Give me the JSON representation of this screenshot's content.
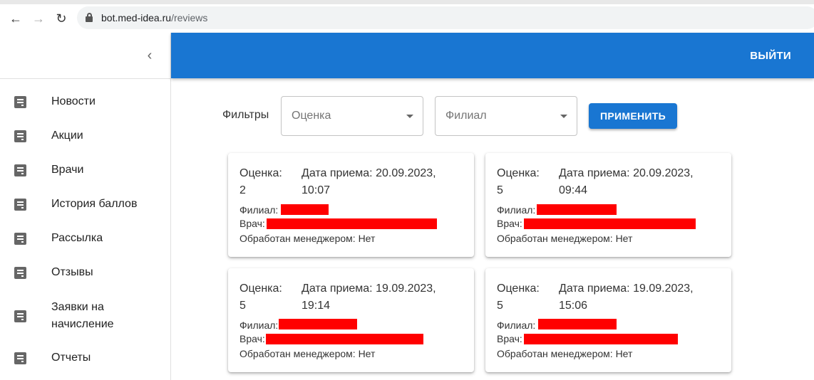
{
  "browser": {
    "url_host": "bot.med-idea.ru",
    "url_path": "/reviews"
  },
  "sidebar": {
    "items": [
      {
        "label": "Новости"
      },
      {
        "label": "Акции"
      },
      {
        "label": "Врачи"
      },
      {
        "label": "История баллов"
      },
      {
        "label": "Рассылка"
      },
      {
        "label": "Отзывы"
      },
      {
        "label": "Заявки на начисление"
      },
      {
        "label": "Отчеты"
      }
    ]
  },
  "header": {
    "logout_label": "ВЫЙТИ",
    "accent_color": "#1976d2"
  },
  "filters": {
    "label": "Фильтры",
    "rating_placeholder": "Оценка",
    "branch_placeholder": "Филиал",
    "apply_label": "ПРИМЕНИТЬ"
  },
  "reviews": [
    {
      "rating_label": "Оценка:",
      "rating": "2",
      "date_label": "Дата приема:",
      "date": "20.09.2023,",
      "time": "10:07",
      "branch_label": "Филиал:",
      "doctor_label": "Врач:",
      "processed_label": "Обработан менеджером:",
      "processed": "Нет"
    },
    {
      "rating_label": "Оценка:",
      "rating": "5",
      "date_label": "Дата приема:",
      "date": "20.09.2023,",
      "time": "09:44",
      "branch_label": "Филиал:",
      "doctor_label": "Врач:",
      "processed_label": "Обработан менеджером:",
      "processed": "Нет"
    },
    {
      "rating_label": "Оценка:",
      "rating": "5",
      "date_label": "Дата приема:",
      "date": "19.09.2023,",
      "time": "19:14",
      "branch_label": "Филиал:",
      "doctor_label": "Врач:",
      "processed_label": "Обработан менеджером:",
      "processed": "Нет"
    },
    {
      "rating_label": "Оценка:",
      "rating": "5",
      "date_label": "Дата приема:",
      "date": "19.09.2023,",
      "time": "15:06",
      "branch_label": "Филиал:",
      "doctor_label": "Врач:",
      "processed_label": "Обработан менеджером:",
      "processed": "Нет"
    }
  ]
}
